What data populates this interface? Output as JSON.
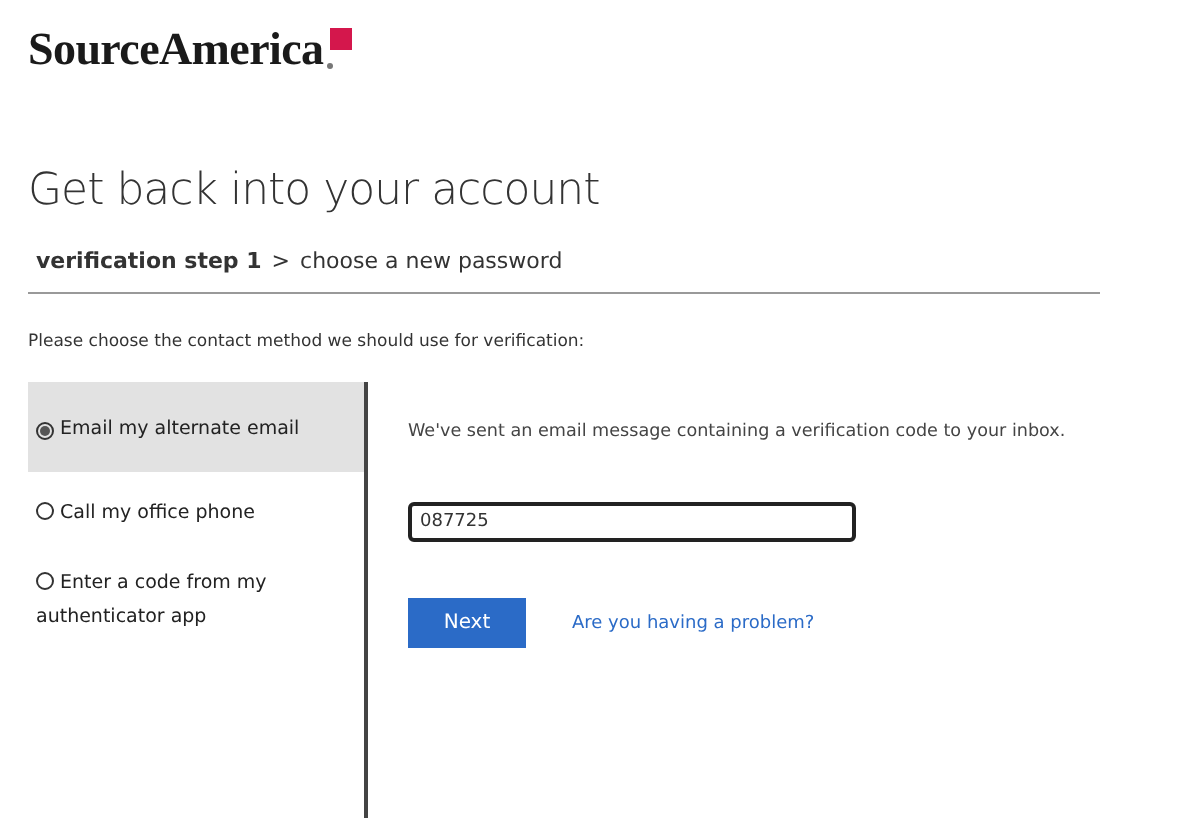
{
  "logo": {
    "text": "SourceAmerica"
  },
  "title": "Get back into your account",
  "steps": {
    "separator": ">",
    "items": [
      {
        "label": "verification step 1",
        "selected": true
      },
      {
        "label": "choose a new password",
        "selected": false
      }
    ]
  },
  "instruction": "Please choose the contact method we should use for verification:",
  "methods": [
    {
      "label": "Email my alternate email",
      "selected": true
    },
    {
      "label": "Call my office phone",
      "selected": false
    },
    {
      "label": "Enter a code from my authenticator app",
      "selected": false
    }
  ],
  "message": "We've sent an email message containing a verification code to your inbox.",
  "code_field": {
    "value": "087725"
  },
  "next_button": "Next",
  "help_link": "Are you having a problem?"
}
